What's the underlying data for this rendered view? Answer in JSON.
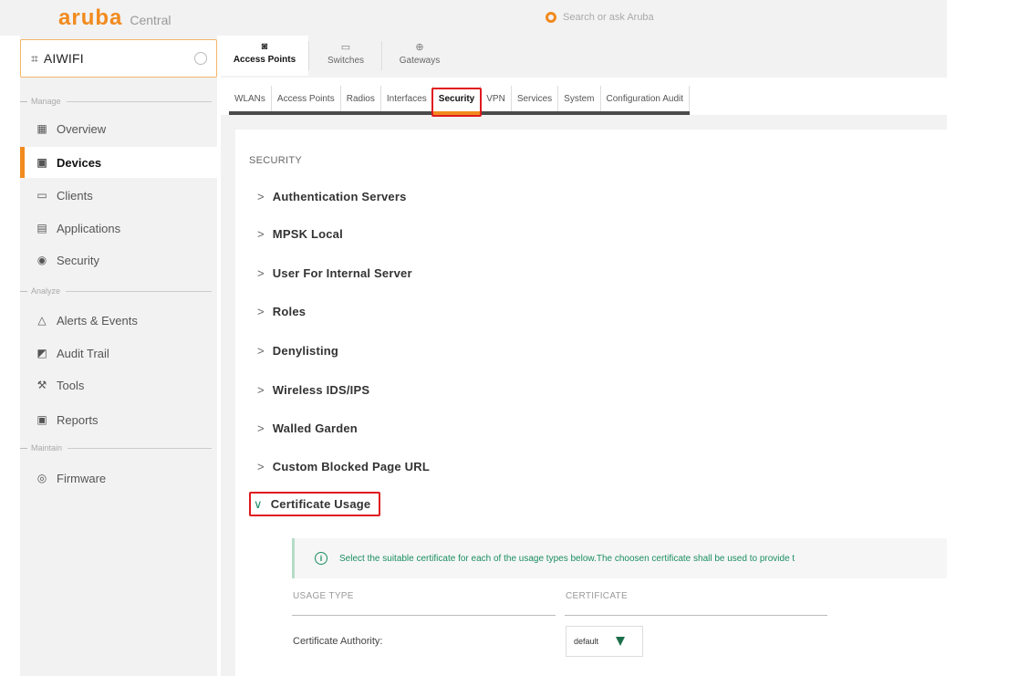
{
  "header": {
    "logo_word": "aruba",
    "logo_sub": "Central",
    "search_placeholder": "Search or ask Aruba"
  },
  "sidebar": {
    "context_label": "AIWIFI",
    "sections": {
      "manage": "Manage",
      "analyze": "Analyze",
      "maintain": "Maintain"
    },
    "items": [
      {
        "label": "Overview",
        "icon": "grid-icon"
      },
      {
        "label": "Devices",
        "icon": "devices-icon"
      },
      {
        "label": "Clients",
        "icon": "clients-icon"
      },
      {
        "label": "Applications",
        "icon": "applications-icon"
      },
      {
        "label": "Security",
        "icon": "security-icon"
      },
      {
        "label": "Alerts & Events",
        "icon": "bell-icon"
      },
      {
        "label": "Audit Trail",
        "icon": "audit-icon"
      },
      {
        "label": "Tools",
        "icon": "wrench-icon"
      },
      {
        "label": "Reports",
        "icon": "reports-icon"
      },
      {
        "label": "Firmware",
        "icon": "firmware-icon"
      }
    ],
    "active": "Devices"
  },
  "device_tabs": [
    {
      "label": "Access Points",
      "icon": "access-point-icon"
    },
    {
      "label": "Switches",
      "icon": "switch-icon"
    },
    {
      "label": "Gateways",
      "icon": "gateway-icon"
    }
  ],
  "config_tabs": [
    "WLANs",
    "Access Points",
    "Radios",
    "Interfaces",
    "Security",
    "VPN",
    "Services",
    "System",
    "Configuration Audit"
  ],
  "config_tab_active": "Security",
  "main": {
    "section_title": "SECURITY",
    "accordion": [
      "Authentication Servers",
      "MPSK Local",
      "User For Internal Server",
      "Roles",
      "Denylisting",
      "Wireless IDS/IPS",
      "Walled Garden",
      "Custom Blocked Page URL",
      "Certificate Usage"
    ],
    "open_item": "Certificate Usage",
    "info_text": "Select the suitable certificate for each of the usage types below.The choosen certificate shall be used to provide t",
    "columns": [
      "USAGE TYPE",
      "CERTIFICATE"
    ],
    "rows": [
      {
        "usage_type": "Certificate Authority:",
        "certificate": "default"
      }
    ]
  },
  "colors": {
    "brand": "#f28a1e",
    "highlight": "#e0191f",
    "info_green": "#1b8e62"
  }
}
